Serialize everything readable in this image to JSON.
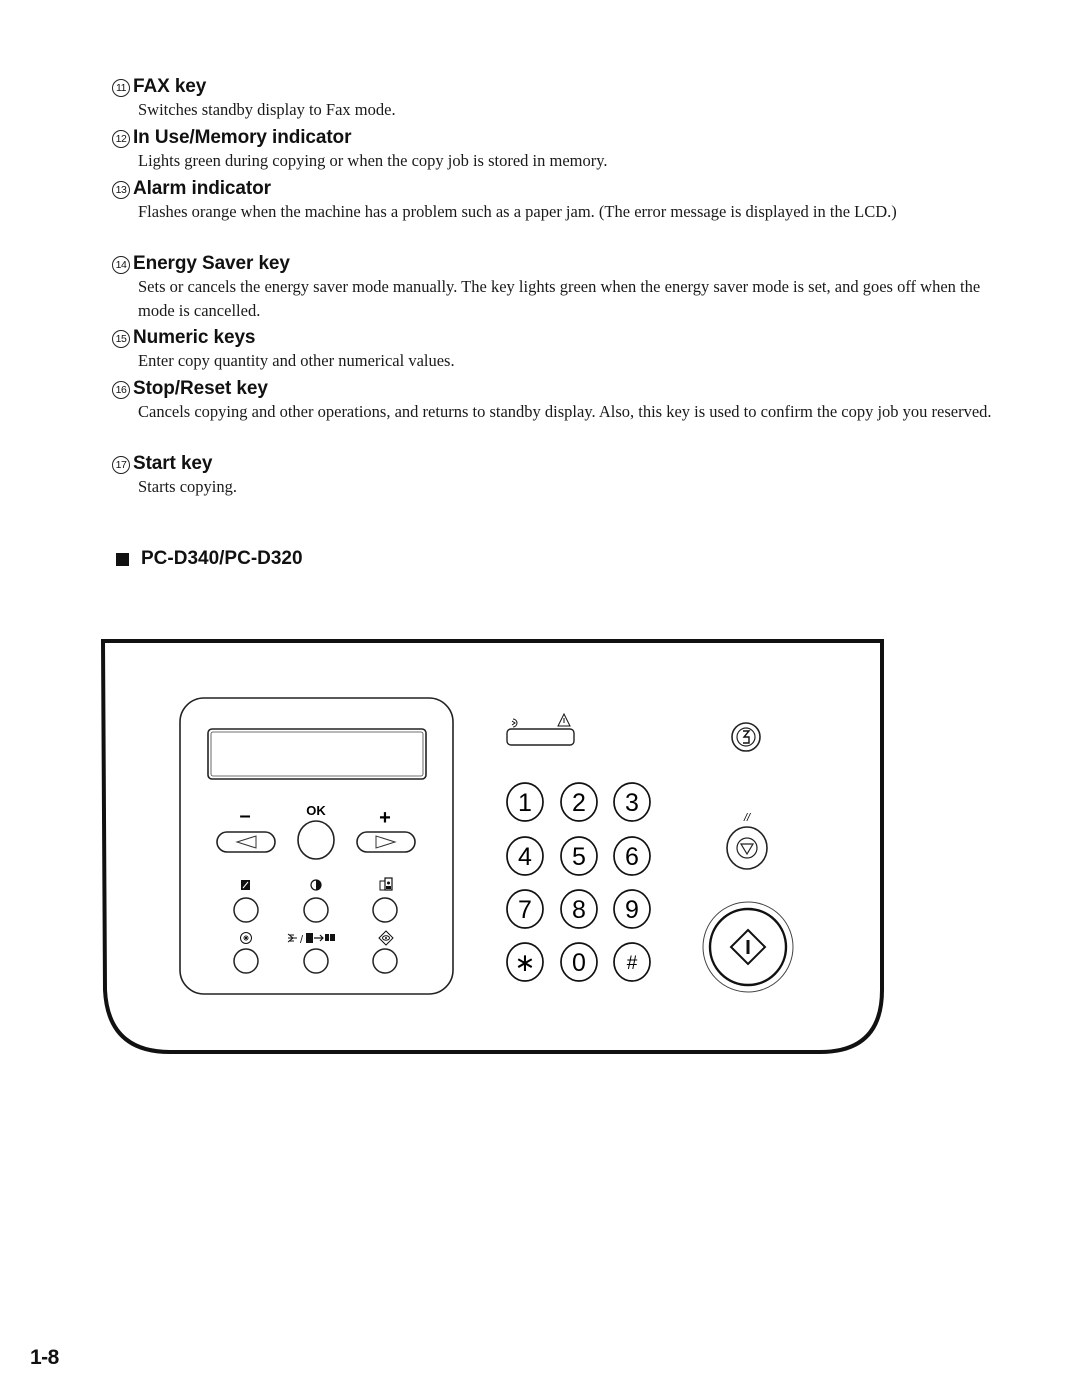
{
  "items": [
    {
      "num": "11",
      "title": "FAX key",
      "desc": "Switches standby display to Fax mode."
    },
    {
      "num": "12",
      "title": "In Use/Memory indicator",
      "desc": "Lights green during copying or when the copy job is stored in memory."
    },
    {
      "num": "13",
      "title": "Alarm indicator",
      "desc": "Flashes orange when the machine has a problem such as a paper jam. (The error message is displayed in the LCD.)"
    },
    {
      "num": "14",
      "title": "Energy Saver key",
      "desc": "Sets or cancels the energy saver mode manually. The key lights green when the energy saver mode is set, and goes off when the mode is cancelled."
    },
    {
      "num": "15",
      "title": "Numeric keys",
      "desc": "Enter copy quantity and other numerical values."
    },
    {
      "num": "16",
      "title": "Stop/Reset key",
      "desc": "Cancels copying and other operations, and returns to standby display. Also, this key is used to confirm the copy job you reserved."
    },
    {
      "num": "17",
      "title": "Start key",
      "desc": "Starts copying."
    }
  ],
  "section": {
    "title": "PC-D340/PC-D320"
  },
  "panel": {
    "minus_label": "–",
    "ok_label": "OK",
    "plus_label": "+",
    "left_arrow_icon": "triangle-left-icon",
    "right_arrow_icon": "triangle-right-icon",
    "function_keys_row1": [
      "exposure-icon",
      "contrast-icon",
      "image-quality-icon"
    ],
    "function_keys_row2": [
      "additional-functions-icon",
      "two-sided-icon",
      "enlarge-reduce-icon"
    ],
    "indicators": [
      "in-use-memory-icon",
      "alarm-icon"
    ],
    "numeric_keys": [
      "1",
      "2",
      "3",
      "4",
      "5",
      "6",
      "7",
      "8",
      "9",
      "∗",
      "0",
      "#"
    ],
    "reset_label": "//",
    "energy_saver_icon": "energy-saver-icon",
    "stop_icon": "stop-icon",
    "start_icon": "start-icon"
  },
  "page_number": "1-8"
}
